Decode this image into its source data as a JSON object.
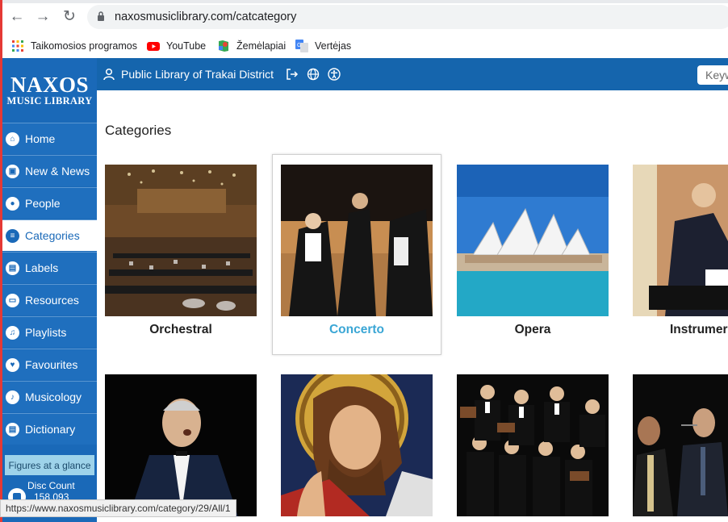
{
  "browser": {
    "url": "naxosmusiclibrary.com/catcategory",
    "bookmarks": [
      {
        "label": "Taikomosios programos",
        "icon": "apps-grid-icon"
      },
      {
        "label": "YouTube",
        "icon": "youtube-icon"
      },
      {
        "label": "Žemėlapiai",
        "icon": "maps-icon"
      },
      {
        "label": "Vertėjas",
        "icon": "translate-icon"
      }
    ],
    "status_url": "https://www.naxosmusiclibrary.com/category/29/All/1"
  },
  "logo": {
    "line1": "NAXOS",
    "line2": "MUSIC LIBRARY"
  },
  "topbar": {
    "library_name": "Public Library of Trakai District",
    "search_placeholder": "Keyw"
  },
  "sidebar": {
    "items": [
      {
        "label": "Home",
        "icon": "home-icon"
      },
      {
        "label": "New & News",
        "icon": "news-icon"
      },
      {
        "label": "People",
        "icon": "person-icon"
      },
      {
        "label": "Categories",
        "icon": "layers-icon"
      },
      {
        "label": "Labels",
        "icon": "label-icon"
      },
      {
        "label": "Resources",
        "icon": "folder-icon"
      },
      {
        "label": "Playlists",
        "icon": "playlist-icon"
      },
      {
        "label": "Favourites",
        "icon": "heart-icon"
      },
      {
        "label": "Musicology",
        "icon": "music-note-icon"
      },
      {
        "label": "Dictionary",
        "icon": "book-icon"
      }
    ],
    "figures_label": "Figures at a glance",
    "disc_count_label": "Disc Count",
    "disc_count_value": "158,093"
  },
  "main": {
    "title": "Categories",
    "categories": [
      {
        "label": "Orchestral"
      },
      {
        "label": "Concerto"
      },
      {
        "label": "Opera"
      },
      {
        "label": "Instrumer"
      },
      {
        "label": ""
      },
      {
        "label": ""
      },
      {
        "label": ""
      },
      {
        "label": ""
      }
    ]
  },
  "colors": {
    "brand": "#1a69b8",
    "active_label": "#3aa6d5"
  }
}
